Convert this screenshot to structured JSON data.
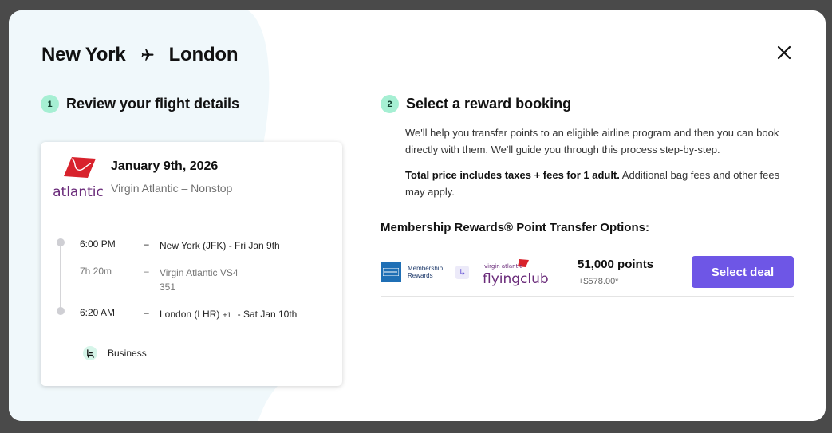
{
  "header": {
    "origin": "New York",
    "destination": "London"
  },
  "step1": {
    "number": "1",
    "title": "Review your flight details"
  },
  "step2": {
    "number": "2",
    "title": "Select a reward booking"
  },
  "flight_card": {
    "airline_logo_text": "atlantic",
    "date": "January 9th, 2026",
    "airline": "Virgin Atlantic – Nonstop",
    "departure": {
      "time": "6:00 PM",
      "dash": "–",
      "desc": "New York (JFK) - Fri Jan 9th"
    },
    "duration": {
      "time": "7h 20m",
      "dash": "–",
      "desc": "Virgin Atlantic VS4 351"
    },
    "arrival": {
      "time": "6:20 AM",
      "dash": "–",
      "desc_start": "London (LHR)",
      "day_offset": "+1",
      "desc_end": "- Sat Jan 10th"
    },
    "cabin": "Business"
  },
  "info": {
    "paragraph1": "We'll help you transfer points to an eligible airline program and then you can book directly with them. We'll guide you through this process step-by-step.",
    "paragraph2_bold": "Total price includes taxes + fees for 1 adult.",
    "paragraph2_rest": " Additional bag fees and other fees may apply."
  },
  "transfer": {
    "title": "Membership Rewards® Point Transfer Options:",
    "program_line1": "Membership",
    "program_line2": "Rewards",
    "partner_small": "virgin atlantic",
    "partner_name": "flyingclub",
    "points": "51,000 points",
    "cash": "+$578.00*",
    "select_label": "Select deal"
  },
  "colors": {
    "accent": "#6e56e6",
    "step_badge": "#a6efd3",
    "virgin_red": "#d8222c",
    "virgin_purple": "#6a2b7a"
  }
}
